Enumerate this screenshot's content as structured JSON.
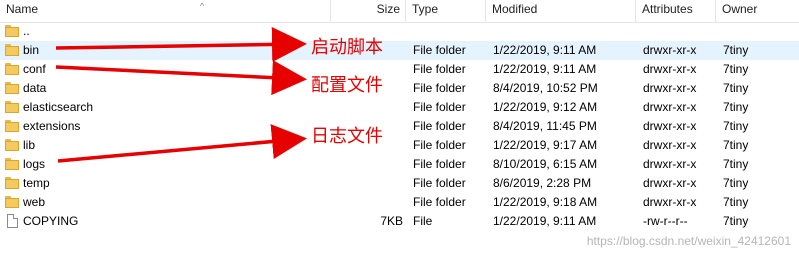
{
  "columns": {
    "name": "Name",
    "size": "Size",
    "type": "Type",
    "modified": "Modified",
    "attributes": "Attributes",
    "owner": "Owner"
  },
  "rows": [
    {
      "name": "..",
      "size": "",
      "type": "",
      "modified": "",
      "attributes": "",
      "owner": "",
      "icon": "folder-icon"
    },
    {
      "name": "bin",
      "size": "",
      "type": "File folder",
      "modified": "1/22/2019, 9:11 AM",
      "attributes": "drwxr-xr-x",
      "owner": "7tiny",
      "icon": "folder-icon",
      "selected": true
    },
    {
      "name": "conf",
      "size": "",
      "type": "File folder",
      "modified": "1/22/2019, 9:11 AM",
      "attributes": "drwxr-xr-x",
      "owner": "7tiny",
      "icon": "folder-icon"
    },
    {
      "name": "data",
      "size": "",
      "type": "File folder",
      "modified": "8/4/2019, 10:52 PM",
      "attributes": "drwxr-xr-x",
      "owner": "7tiny",
      "icon": "folder-icon"
    },
    {
      "name": "elasticsearch",
      "size": "",
      "type": "File folder",
      "modified": "1/22/2019, 9:12 AM",
      "attributes": "drwxr-xr-x",
      "owner": "7tiny",
      "icon": "folder-icon"
    },
    {
      "name": "extensions",
      "size": "",
      "type": "File folder",
      "modified": "8/4/2019, 11:45 PM",
      "attributes": "drwxr-xr-x",
      "owner": "7tiny",
      "icon": "folder-icon"
    },
    {
      "name": "lib",
      "size": "",
      "type": "File folder",
      "modified": "1/22/2019, 9:17 AM",
      "attributes": "drwxr-xr-x",
      "owner": "7tiny",
      "icon": "folder-icon"
    },
    {
      "name": "logs",
      "size": "",
      "type": "File folder",
      "modified": "8/10/2019, 6:15 AM",
      "attributes": "drwxr-xr-x",
      "owner": "7tiny",
      "icon": "folder-icon"
    },
    {
      "name": "temp",
      "size": "",
      "type": "File folder",
      "modified": "8/6/2019, 2:28 PM",
      "attributes": "drwxr-xr-x",
      "owner": "7tiny",
      "icon": "folder-icon"
    },
    {
      "name": "web",
      "size": "",
      "type": "File folder",
      "modified": "1/22/2019, 9:18 AM",
      "attributes": "drwxr-xr-x",
      "owner": "7tiny",
      "icon": "folder-icon"
    },
    {
      "name": "COPYING",
      "size": "7KB",
      "type": "File",
      "modified": "1/22/2019, 9:11 AM",
      "attributes": "-rw-r--r--",
      "owner": "7tiny",
      "icon": "file-icon"
    }
  ],
  "annotations": {
    "startup_scripts": "启动脚本",
    "config_files": "配置文件",
    "log_files": "日志文件",
    "color": "#e60000"
  },
  "watermark": "https://blog.csdn.net/weixin_42412601"
}
